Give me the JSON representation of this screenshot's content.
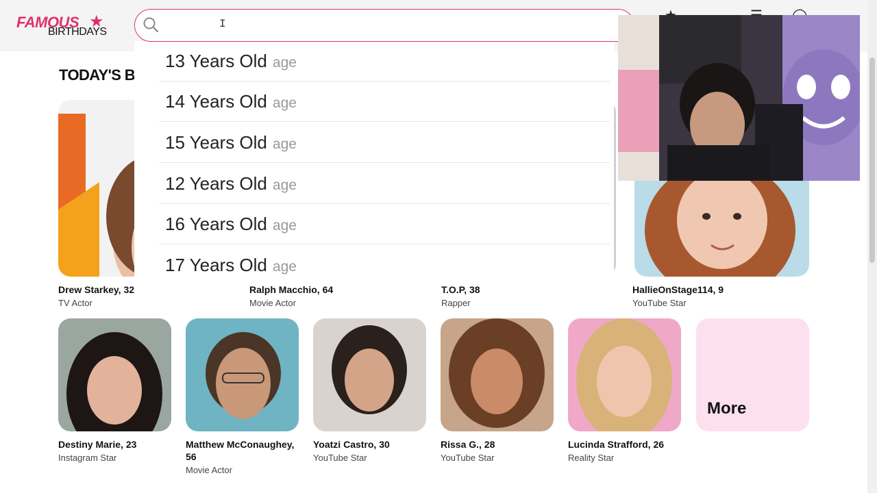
{
  "logo": {
    "famous": "FAMOUS",
    "birthdays": "BIRTHDAYS"
  },
  "search": {
    "value": "",
    "placeholder": ""
  },
  "suggestions": [
    {
      "label": "13 Years Old",
      "tag": "age"
    },
    {
      "label": "14 Years Old",
      "tag": "age"
    },
    {
      "label": "15 Years Old",
      "tag": "age"
    },
    {
      "label": "12 Years Old",
      "tag": "age"
    },
    {
      "label": "16 Years Old",
      "tag": "age"
    },
    {
      "label": "17 Years Old",
      "tag": "age"
    }
  ],
  "section": {
    "title": "TODAY'S BIRTHDAYS"
  },
  "featured": [
    {
      "name": "Drew Starkey, 32",
      "role": "TV Actor"
    },
    {
      "name": "Ralph Macchio, 64",
      "role": "Movie Actor"
    },
    {
      "name": "T.O.P, 38",
      "role": "Rapper"
    },
    {
      "name": "HallieOnStage114, 9",
      "role": "YouTube Star"
    }
  ],
  "grid": [
    {
      "name": "Destiny Marie, 23",
      "role": "Instagram Star"
    },
    {
      "name": "Matthew McConaughey, 56",
      "role": "Movie Actor"
    },
    {
      "name": "Yoatzi Castro, 30",
      "role": "YouTube Star"
    },
    {
      "name": "Rissa G., 28",
      "role": "YouTube Star"
    },
    {
      "name": "Lucinda Strafford, 26",
      "role": "Reality Star"
    }
  ],
  "more_label": "More",
  "colors": {
    "brand": "#e0306b",
    "more_bg": "#fde0ee"
  }
}
